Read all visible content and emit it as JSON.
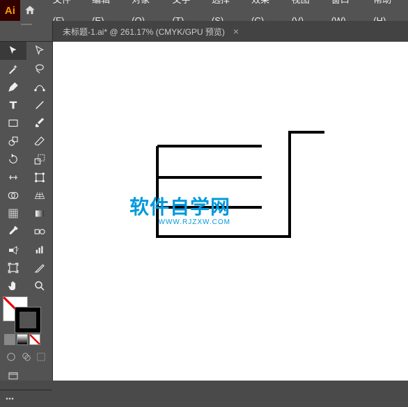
{
  "app": {
    "logo": "Ai"
  },
  "menu": {
    "file": "文件(F)",
    "edit": "编辑(E)",
    "object": "对象(O)",
    "type": "文字(T)",
    "select": "选择(S)",
    "effect": "效果(C)",
    "view": "视图(V)",
    "window": "窗口(W)",
    "help": "帮助(H)"
  },
  "tab": {
    "title": "未标题-1.ai* @ 261.17% (CMYK/GPU 预览)",
    "close": "×"
  },
  "watermark": {
    "main": "软件自学网",
    "sub": "WWW.RJZXW.COM"
  },
  "colors": {
    "accent": "#ff9a00",
    "watermark": "#0099dd"
  }
}
